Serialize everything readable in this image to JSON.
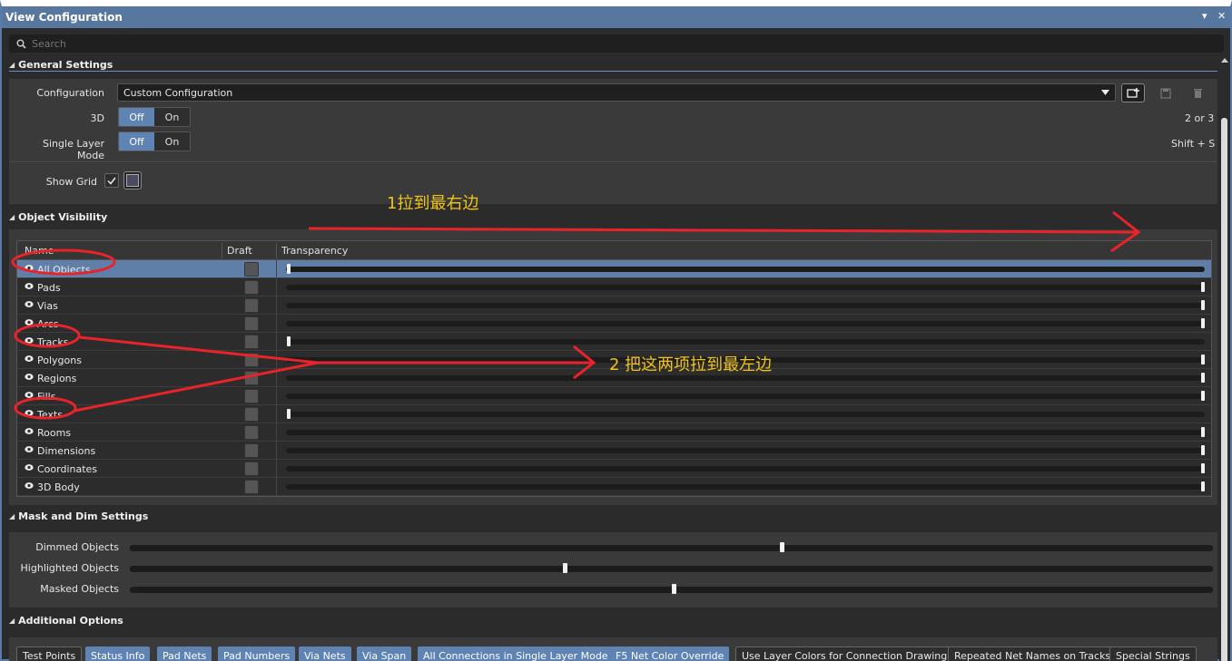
{
  "window": {
    "title": "View Configuration",
    "menu_glyph": "▾",
    "close_glyph": "✕"
  },
  "search": {
    "placeholder": "Search"
  },
  "general": {
    "header": "General Settings",
    "configuration_label": "Configuration",
    "configuration_value": "Custom Configuration",
    "threed_label": "3D",
    "threed_off": "Off",
    "threed_on": "On",
    "threed_shortcut": "2 or 3",
    "single_layer_label": "Single Layer Mode",
    "single_layer_off": "Off",
    "single_layer_on": "On",
    "single_layer_shortcut": "Shift + S",
    "show_grid_label": "Show Grid",
    "show_grid_checked": true
  },
  "object_visibility": {
    "header": "Object Visibility",
    "columns": {
      "name": "Name",
      "draft": "Draft",
      "transparency": "Transparency"
    },
    "rows": [
      {
        "name": "All Objects",
        "transparency": 0,
        "selected": true
      },
      {
        "name": "Pads",
        "transparency": 100
      },
      {
        "name": "Vias",
        "transparency": 100
      },
      {
        "name": "Arcs",
        "transparency": 100
      },
      {
        "name": "Tracks",
        "transparency": 0
      },
      {
        "name": "Polygons",
        "transparency": 100
      },
      {
        "name": "Regions",
        "transparency": 100
      },
      {
        "name": "Fills",
        "transparency": 100
      },
      {
        "name": "Texts",
        "transparency": 0
      },
      {
        "name": "Rooms",
        "transparency": 100
      },
      {
        "name": "Dimensions",
        "transparency": 100
      },
      {
        "name": "Coordinates",
        "transparency": 100
      },
      {
        "name": "3D Body",
        "transparency": 100
      }
    ]
  },
  "mask_dim": {
    "header": "Mask and Dim Settings",
    "items": [
      {
        "label": "Dimmed Objects",
        "value": 60
      },
      {
        "label": "Highlighted Objects",
        "value": 40
      },
      {
        "label": "Masked Objects",
        "value": 50
      }
    ]
  },
  "additional": {
    "header": "Additional Options",
    "chips": [
      {
        "label": "Test Points",
        "active": false
      },
      {
        "label": "Status Info",
        "active": true
      },
      {
        "label": "Pad Nets",
        "active": true
      },
      {
        "label": "Pad Numbers",
        "active": true
      },
      {
        "label": "Via Nets",
        "active": true
      },
      {
        "label": "Via Span",
        "active": true
      },
      {
        "label": "All Connections in Single Layer Mode",
        "active": true
      },
      {
        "label": "F5  Net Color Override",
        "active": true
      },
      {
        "label": "Use Layer Colors for Connection Drawing",
        "active": false
      },
      {
        "label": "Repeated Net Names on Tracks",
        "active": false
      },
      {
        "label": "Special Strings",
        "active": false
      }
    ]
  },
  "annotations": {
    "note1": "1拉到最右边",
    "note2": "2 把这两项拉到最左边",
    "color": "#e8232a"
  },
  "colors": {
    "accent": "#5f83b2",
    "title_bar": "#58779f",
    "annotation_text": "#f0c419"
  }
}
